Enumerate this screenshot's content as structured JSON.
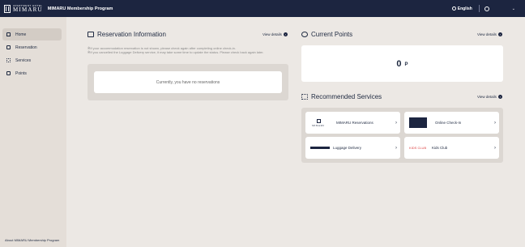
{
  "header": {
    "brand_small": "APARTMENT HOTEL",
    "brand_main": "MIMARU",
    "app_title": "MIMARU Membership Program",
    "language": "English"
  },
  "sidebar": {
    "items": [
      {
        "label": "Home",
        "icon": "home-icon"
      },
      {
        "label": "Reservation",
        "icon": "calendar-icon"
      },
      {
        "label": "Services",
        "icon": "grid-icon"
      },
      {
        "label": "Points",
        "icon": "points-icon"
      }
    ],
    "footer": "About MIMARU Membership Program"
  },
  "reservation": {
    "title": "Reservation Information",
    "view_details": "View details",
    "notice_1": "※If your accommodation reservation is not shown, please check again after completing online check-in.",
    "notice_2": "※If you cancelled the Luggage Delivery service, it may take some time to update the status. Please check back again later.",
    "empty": "Currently, you have no reservations"
  },
  "points": {
    "title": "Current Points",
    "view_details": "View details",
    "value": "0",
    "unit": "P"
  },
  "services": {
    "title": "Recommended Services",
    "view_details": "View details",
    "mimaru_logo_text": "MIMARU",
    "kids_logo_text": "KIDS CLUB",
    "items": [
      {
        "label": "MIMARU Reservations"
      },
      {
        "label": "Online Check-In"
      },
      {
        "label": "Luggage Delivery"
      },
      {
        "label": "Kids Club"
      }
    ]
  },
  "colors": {
    "navy": "#1c2540",
    "background": "#ece8e4",
    "panel": "#dcd7d2"
  }
}
